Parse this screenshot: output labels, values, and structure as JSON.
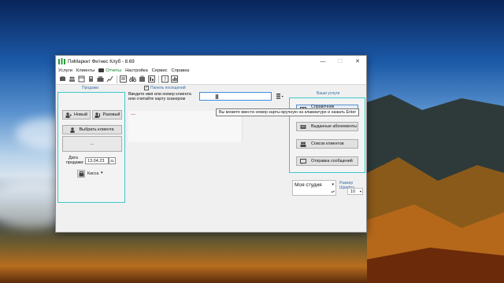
{
  "window": {
    "title": "ПиМаркет Фитнес Клуб - 8.69",
    "controls": {
      "minimize": "—",
      "maximize": "☐",
      "close": "✕"
    }
  },
  "menu": {
    "items": [
      {
        "label": "Услуги"
      },
      {
        "label": "Клиенты"
      },
      {
        "label": "Отчеты",
        "icon": "report-icon"
      },
      {
        "label": "Настройка"
      },
      {
        "label": "Сервис"
      },
      {
        "label": "Справка"
      }
    ]
  },
  "toolbar": {
    "icons": [
      "sales-icon",
      "clients-icon",
      "calendar-icon",
      "money-icon",
      "cashbox-icon",
      "chart-icon",
      "scales-icon",
      "bag-icon",
      "card-icon",
      "help-icon",
      "stats-icon"
    ]
  },
  "sales": {
    "section_label": "Продажи",
    "new_button": "Новый",
    "single_button": "Разовый",
    "select_client_button": "Выбрать клиента",
    "client_value": "...",
    "date_label": "Дата\nпродажи:",
    "date_value": "13.04.23",
    "calendar_value": "31",
    "cash_label": "Касса"
  },
  "visits": {
    "checkbox_label": "Панель посещений",
    "checked": true
  },
  "search": {
    "label": "Введите имя или номер клиента или считайте карту сканером",
    "value": "",
    "tooltip": "Вы можете ввести номер карты вручную на клавиатуре и нажать Enter",
    "result_placeholder": "---"
  },
  "services": {
    "section_label": "Ваши услуги",
    "buttons": [
      {
        "label": "Справочник абонементов"
      },
      {
        "label": "Выданные абонементы"
      },
      {
        "label": "Список клиентов"
      },
      {
        "label": "Отправка сообщений"
      }
    ]
  },
  "studio": {
    "value": "Моя студия"
  },
  "font_size": {
    "label": "Размер Шрифта",
    "value": "10"
  },
  "colors": {
    "accent_border": "#3cc9c9",
    "section_label": "#3a6ea5",
    "focus_border": "#3b8be0",
    "active_menu": "#0a7a27"
  }
}
